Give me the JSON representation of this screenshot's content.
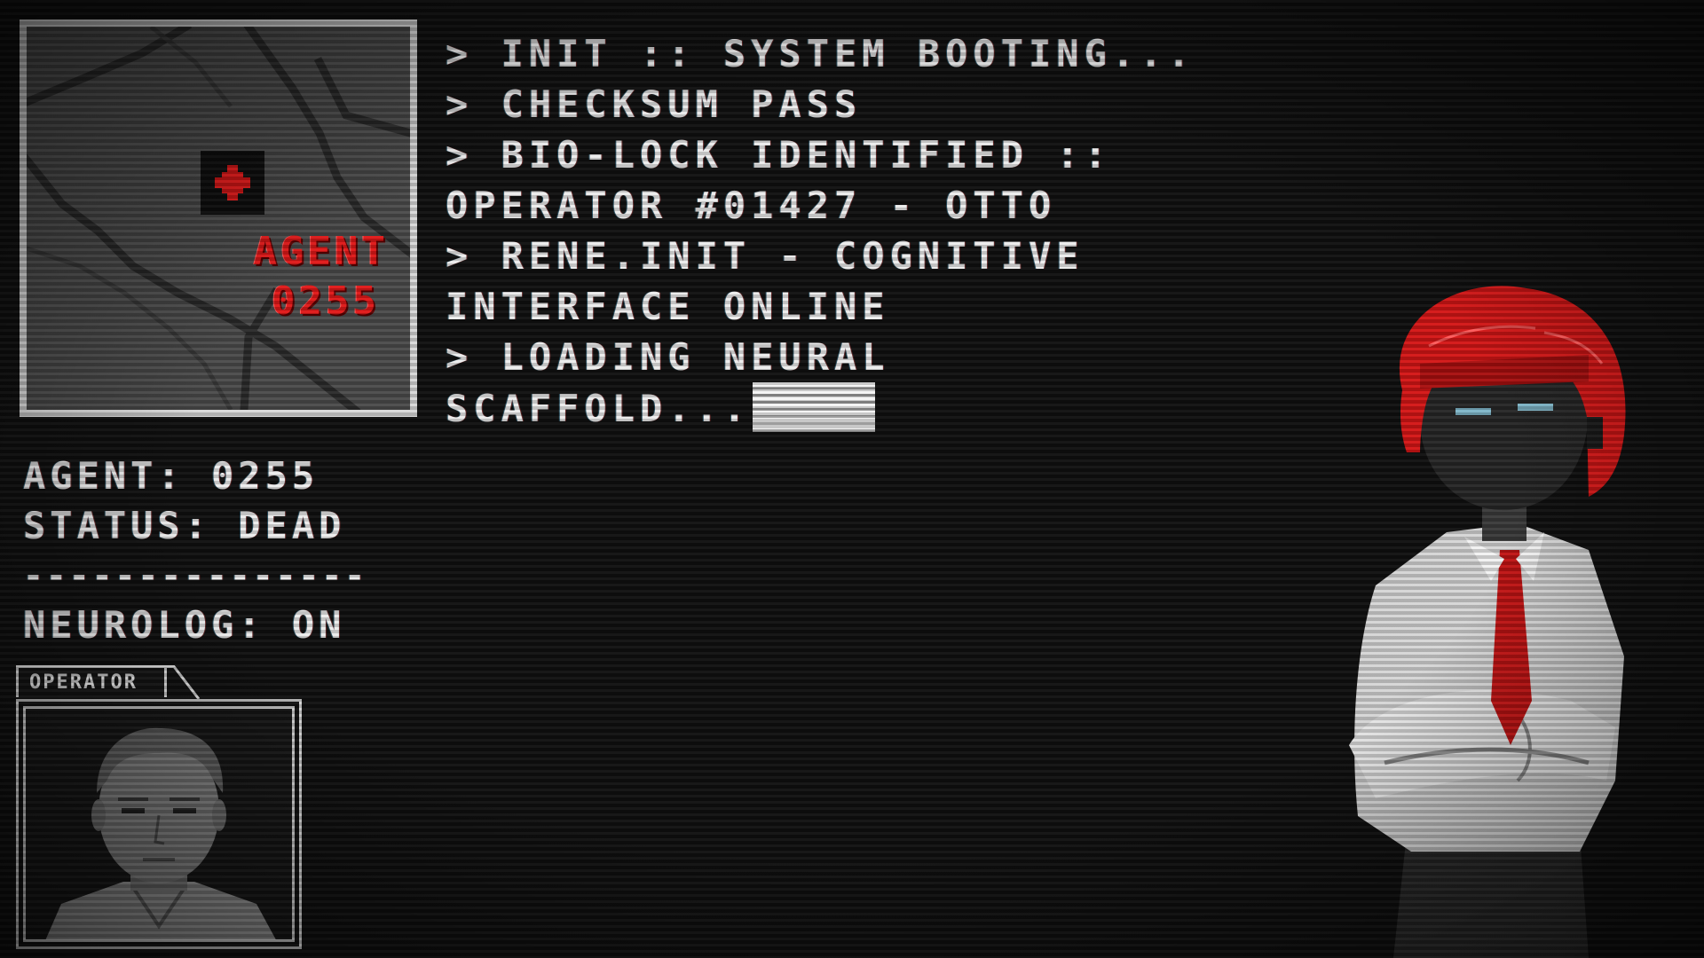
{
  "map": {
    "agent_label": "AGENT",
    "agent_id": "0255"
  },
  "boot_log": {
    "lines": [
      "> INIT :: SYSTEM BOOTING...",
      "> CHECKSUM PASS",
      "> BIO-LOCK IDENTIFIED ::",
      "OPERATOR #01427 - OTTO",
      "> RENE.INIT - COGNITIVE",
      "INTERFACE ONLINE",
      "> LOADING NEURAL",
      "SCAFFOLD..."
    ]
  },
  "agent_info": {
    "agent": "AGENT: 0255",
    "status": "STATUS: DEAD",
    "divider": "---------------",
    "neurolog": "NEUROLOG: ON"
  },
  "operator": {
    "tab_label": "OPERATOR"
  },
  "colors": {
    "background": "#101010",
    "text": "#ececec",
    "accent_red": "#e01818",
    "map_floor": "#4a4a4a",
    "frame": "#d8d8d8"
  },
  "icons": {
    "map_marker": "medical-cross-icon"
  }
}
